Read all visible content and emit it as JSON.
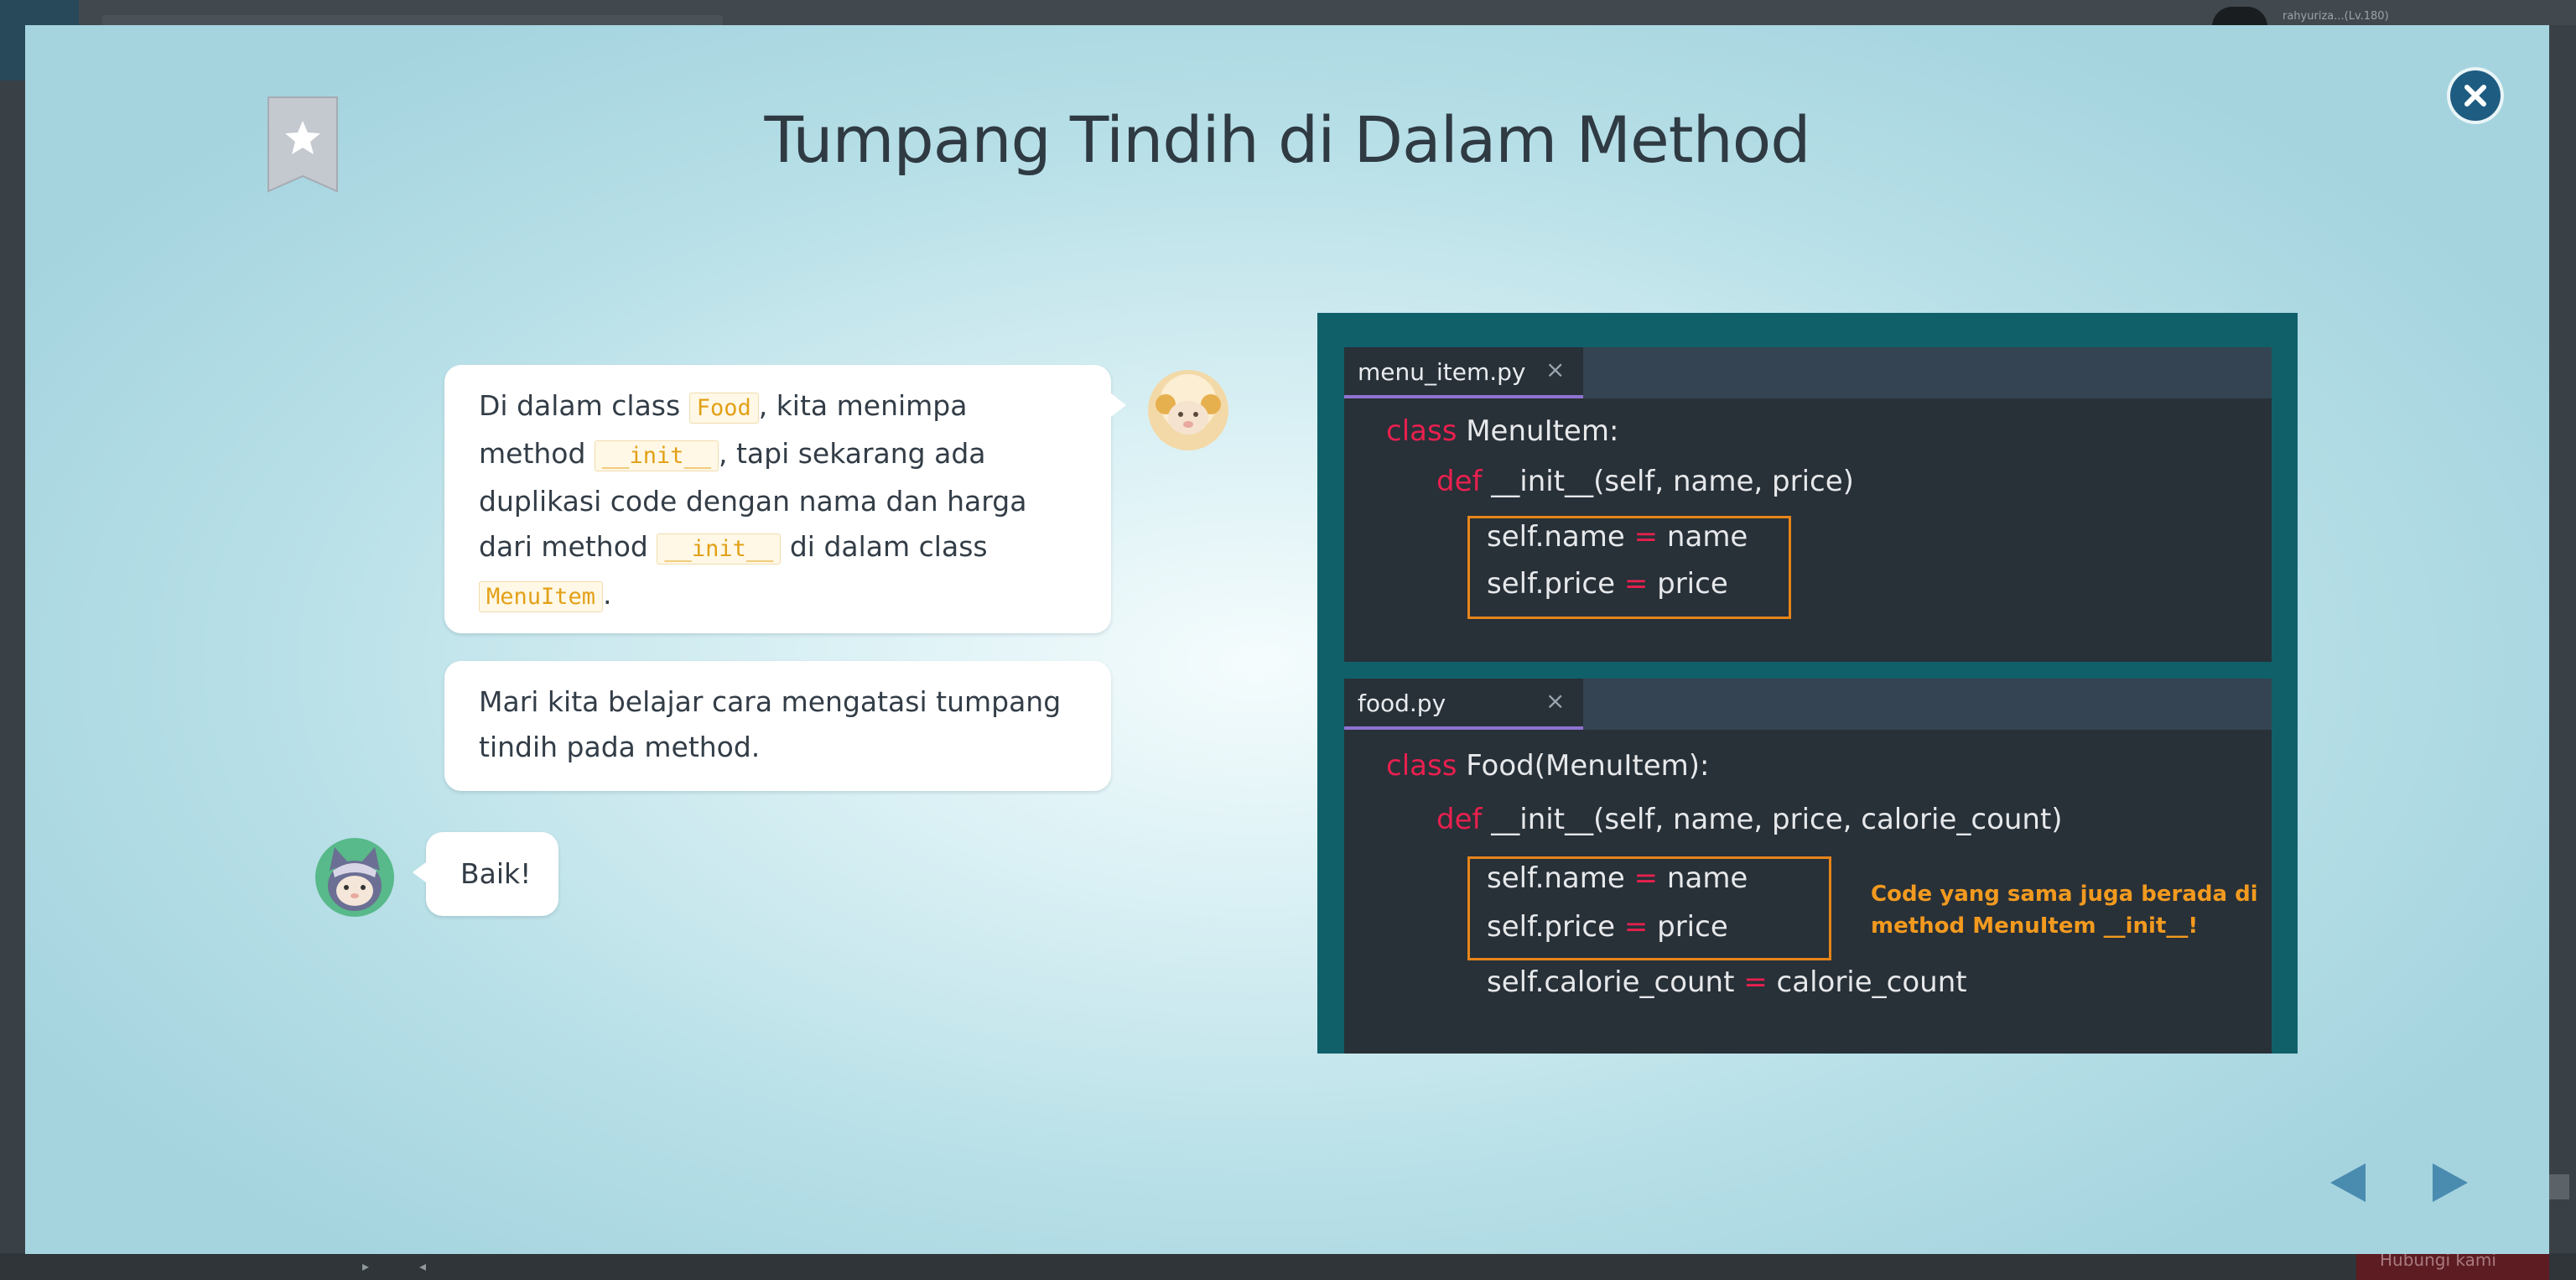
{
  "background": {
    "user_name": "rahyuriza...(Lv.180)",
    "help_label": "Hubungi kami"
  },
  "slide": {
    "title": "Tumpang Tindih di Dalam Method",
    "bubble1": {
      "t1": "Di dalam class ",
      "c1": "Food",
      "t2": ", kita menimpa method ",
      "c2": "__init__",
      "t3": ", tapi sekarang ada duplikasi code dengan nama dan harga dari method ",
      "c3": "__init__",
      "t4": " di dalam class ",
      "c4": "MenuItem",
      "t5": "."
    },
    "bubble2": "Mari kita belajar cara mengatasi tumpang tindih pada method.",
    "reply": "Baik!",
    "code_image": {
      "file1": {
        "tab": "menu_item.py",
        "tab_close": "×",
        "kw_class": "class",
        "class_rest": " MenuItem:",
        "kw_def": "def",
        "def_rest": " __init__(self, name, price)",
        "line3a": "self.name ",
        "line3eq": "=",
        "line3b": " name",
        "line4a": "self.price ",
        "line4eq": "=",
        "line4b": " price"
      },
      "file2": {
        "tab": "food.py",
        "tab_close": "×",
        "kw_class": "class",
        "class_rest": " Food(MenuItem):",
        "kw_def": "def",
        "def_rest": " __init__(self, name, price, calorie_count)",
        "line3a": "self.name ",
        "line3eq": "=",
        "line3b": " name",
        "line4a": "self.price ",
        "line4eq": "=",
        "line4b": " price",
        "line5a": "self.calorie_count ",
        "line5eq": "=",
        "line5b": " calorie_count",
        "note": "Code yang sama juga berada di method MenuItem __init__!"
      }
    }
  },
  "colors": {
    "accent_blue": "#1f5c82",
    "keyword": "#e8204e",
    "highlight": "#e7851a",
    "code_bg": "#283038",
    "panel_bg": "#10606a"
  }
}
